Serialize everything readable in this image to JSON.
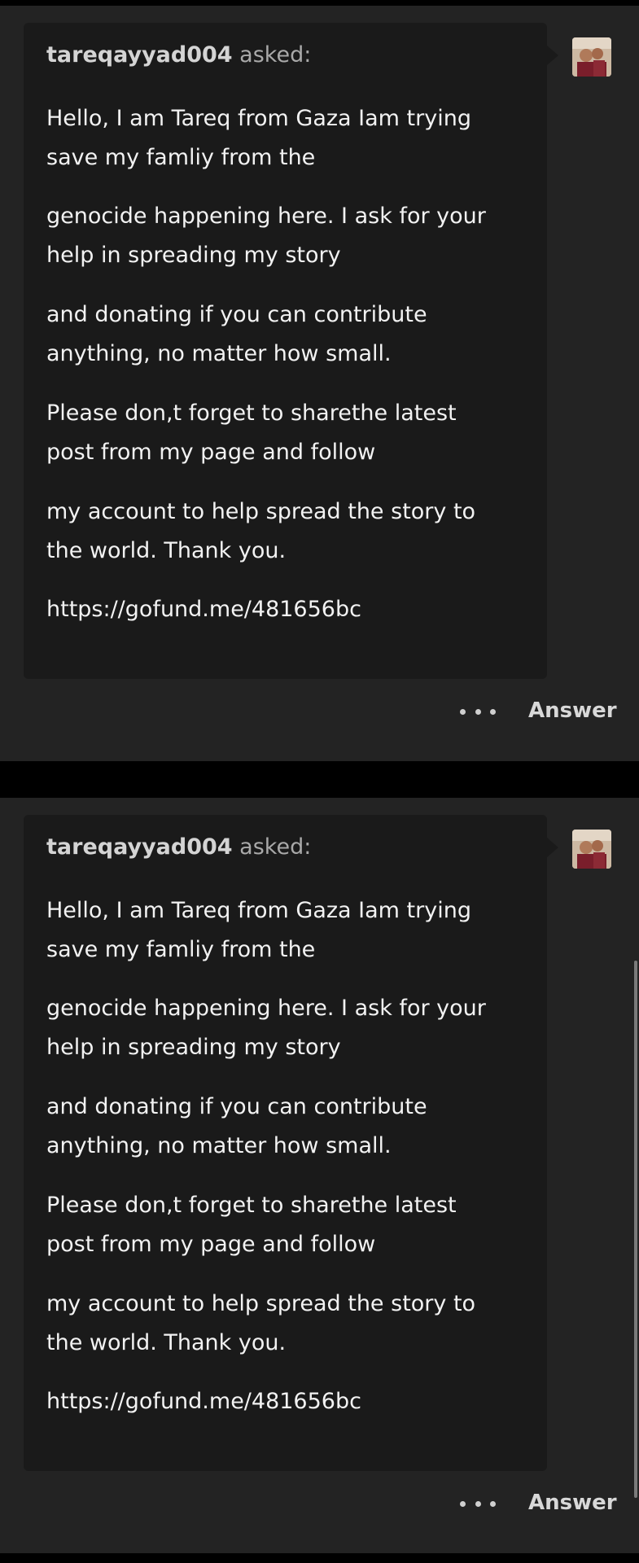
{
  "posts": [
    {
      "asker": "tareqayyad004",
      "asked_label": "asked:",
      "paragraphs": [
        "Hello, I am Tareq from Gaza Iam trying\nsave my famliy from the",
        "genocide happening here. I ask for your\nhelp in spreading my story",
        "and donating if you can contribute\nanything, no matter how small.",
        "Please don,t forget to sharethe latest\npost from my page and follow",
        "my account to help spread the story to\nthe world. Thank you.",
        "https://gofund.me/481656bc"
      ],
      "more_icon": "more-dots-icon",
      "answer_label": "Answer"
    },
    {
      "asker": "tareqayyad004",
      "asked_label": "asked:",
      "paragraphs": [
        "Hello, I am Tareq from Gaza Iam trying\nsave my famliy from the",
        "genocide happening here. I ask for your\nhelp in spreading my story",
        "and donating if you can contribute\nanything, no matter how small.",
        "Please don,t forget to sharethe latest\npost from my page and follow",
        "my account to help spread the story to\nthe world. Thank you.",
        "https://gofund.me/481656bc"
      ],
      "more_icon": "more-dots-icon",
      "answer_label": "Answer"
    }
  ],
  "colors": {
    "page_background": "#000000",
    "post_background": "#232323",
    "bubble_background": "#1a1a1a",
    "text": "#f2f2f2",
    "asker_name": "#d4d4d4",
    "muted": "#a9a9a9"
  }
}
